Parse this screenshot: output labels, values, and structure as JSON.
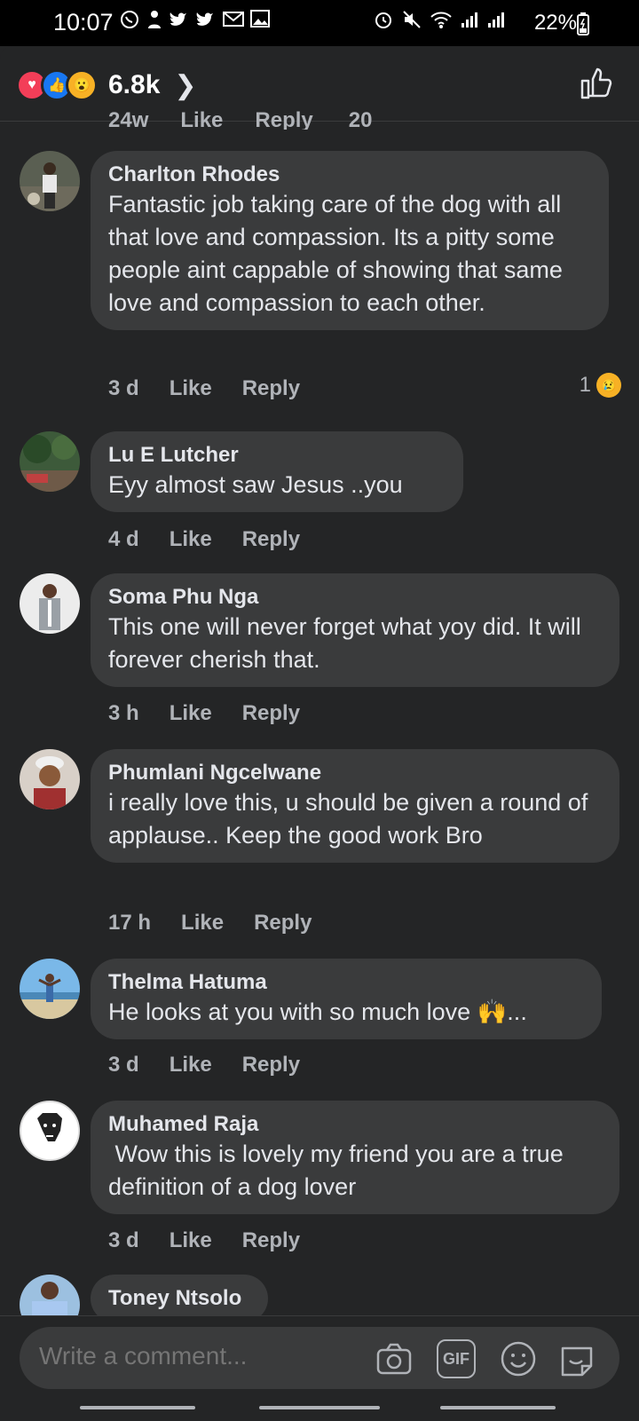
{
  "status": {
    "time": "10:07",
    "left_icons": [
      "whatsapp-icon",
      "person-icon",
      "twitter-icon",
      "twitter-icon",
      "gmail-icon",
      "gallery-icon"
    ],
    "battery": "22%"
  },
  "header": {
    "reaction_types": [
      "love",
      "like",
      "wow"
    ],
    "reaction_count": "6.8k"
  },
  "cutoff": {
    "items": [
      "24w",
      "Like",
      "Reply",
      "20"
    ]
  },
  "comments": [
    {
      "name": "Charlton Rhodes",
      "text": "Fantastic job taking care of the dog with all that love and compassion. Its a pitty some people aint cappable of showing that same love and compassion to each other.",
      "time": "3 d",
      "like": "Like",
      "reply": "Reply",
      "reactions": "1"
    },
    {
      "name": "Lu E Lutcher",
      "text": "Eyy almost saw Jesus ..you",
      "time": "4 d",
      "like": "Like",
      "reply": "Reply"
    },
    {
      "name": "Soma Phu Nga",
      "text": "This one will never forget what yoy did. It will forever cherish that.",
      "time": "3 h",
      "like": "Like",
      "reply": "Reply"
    },
    {
      "name": "Phumlani Ngcelwane",
      "text": "i really love this, u should be given a round of applause.. Keep the good work Bro",
      "time": "17 h",
      "like": "Like",
      "reply": "Reply"
    },
    {
      "name": "Thelma Hatuma",
      "text": "He looks at you with so much love 🙌...",
      "time": "3 d",
      "like": "Like",
      "reply": "Reply"
    },
    {
      "name": "Muhamed Raja",
      "text": " Wow this is lovely my friend you are a true definition of a dog lover",
      "time": "3 d",
      "like": "Like",
      "reply": "Reply"
    },
    {
      "name": "Toney Ntsolo"
    }
  ],
  "composer": {
    "placeholder": "Write a comment...",
    "gif_label": "GIF"
  },
  "colors": {
    "background": "#242526",
    "bubble": "#3a3b3c",
    "text": "#e4e6eb",
    "secondary": "#b0b3b8",
    "like_blue": "#1877f2",
    "love_red": "#f33e58"
  }
}
